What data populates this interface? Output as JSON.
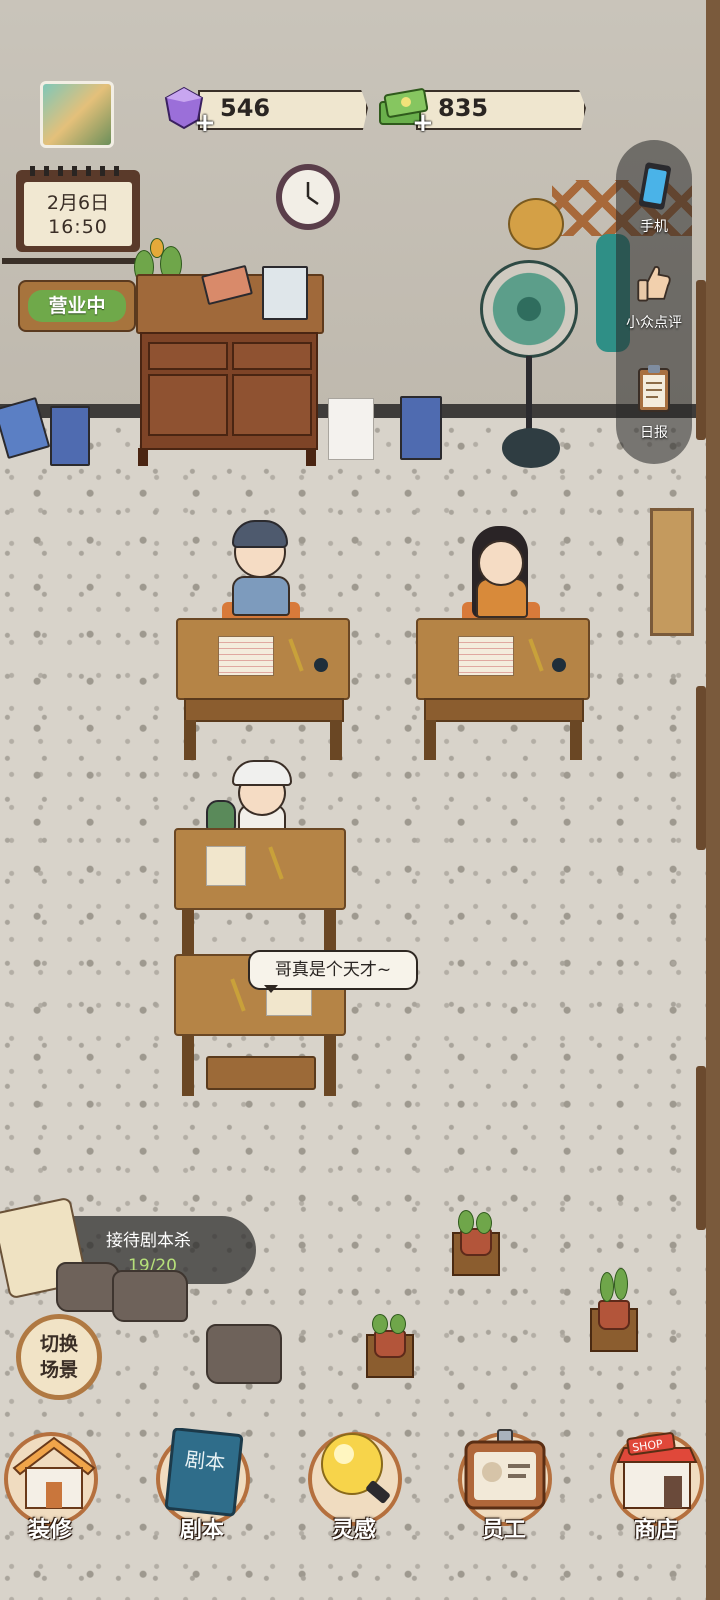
{
  "hud": {
    "gems": "546",
    "cash": "835",
    "gem_plus": "+",
    "cash_plus": "+"
  },
  "calendar": {
    "date": "2月6日",
    "time": "16:50"
  },
  "shop_sign": "营业中",
  "side_menu": {
    "phone": "手机",
    "reviews": "小众点评",
    "daily": "日报"
  },
  "speech": "哥真是个天才~",
  "task": {
    "title": "接待剧本杀",
    "progress": "19/20",
    "progress_value": 0.95
  },
  "switch_scene": {
    "line1": "切换",
    "line2": "场景"
  },
  "nav": [
    {
      "label": "装修",
      "icon": "house-icon"
    },
    {
      "label": "剧本",
      "icon": "script-book-icon"
    },
    {
      "label": "灵感",
      "icon": "lightbulb-icon"
    },
    {
      "label": "员工",
      "icon": "staff-badge-icon"
    },
    {
      "label": "商店",
      "icon": "shop-icon"
    }
  ],
  "colors": {
    "sign_green": "#6fa94a",
    "task_progress": "#b6e07a",
    "gem": "#9b6fd9",
    "cash": "#6ab04c"
  }
}
